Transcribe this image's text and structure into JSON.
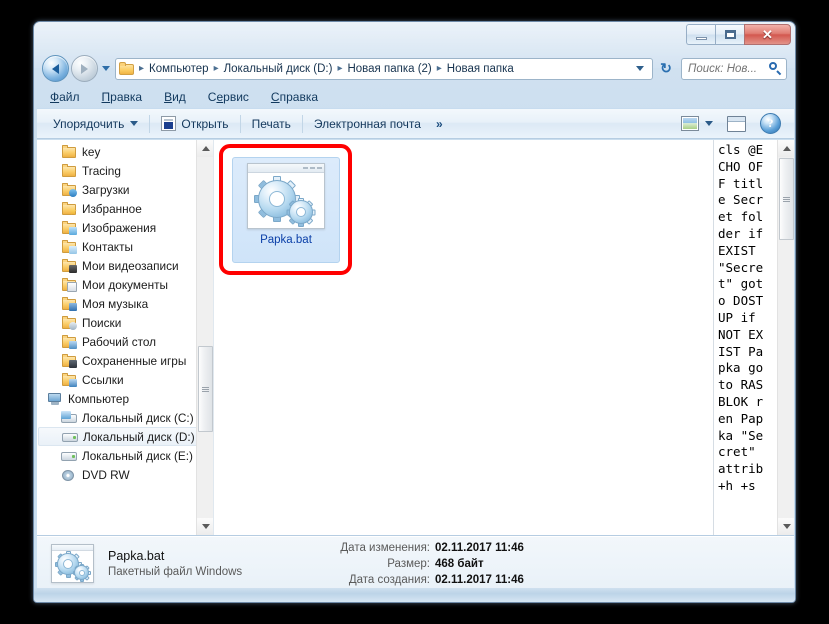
{
  "window": {
    "title": "",
    "controls": {
      "minimize": "–",
      "maximize": "□",
      "close": "✕"
    }
  },
  "nav": {
    "back_tooltip": "Назад",
    "forward_tooltip": "Вперед",
    "breadcrumbs": [
      "Компьютер",
      "Локальный диск (D:)",
      "Новая папка (2)",
      "Новая папка"
    ],
    "separator": "▸",
    "refresh": "↻",
    "search": {
      "placeholder": "Поиск: Нов...",
      "value": ""
    }
  },
  "menubar": {
    "items": [
      {
        "pre": "",
        "accel": "Ф",
        "post": "айл"
      },
      {
        "pre": "",
        "accel": "П",
        "post": "равка"
      },
      {
        "pre": "",
        "accel": "В",
        "post": "ид"
      },
      {
        "pre": "С",
        "accel": "е",
        "post": "рвис"
      },
      {
        "pre": "",
        "accel": "С",
        "post": "правка"
      }
    ]
  },
  "toolbar": {
    "organize": "Упорядочить",
    "open": "Открыть",
    "print": "Печать",
    "email": "Электронная почта",
    "overflow": "»",
    "help": "?"
  },
  "sidebar": {
    "items": [
      {
        "label": "key",
        "icon": "folder-icon",
        "kind": "folder",
        "level": 1,
        "selected": false
      },
      {
        "label": "Tracing",
        "icon": "folder-icon",
        "kind": "folder",
        "level": 1,
        "selected": false
      },
      {
        "label": "Загрузки",
        "icon": "downloads-folder-icon",
        "kind": "folder",
        "badge": "dl",
        "level": 1,
        "selected": false
      },
      {
        "label": "Избранное",
        "icon": "favorites-folder-icon",
        "kind": "folder",
        "badge": "fav",
        "level": 1,
        "selected": false
      },
      {
        "label": "Изображения",
        "icon": "pictures-folder-icon",
        "kind": "folder",
        "badge": "pic",
        "level": 1,
        "selected": false
      },
      {
        "label": "Контакты",
        "icon": "contacts-folder-icon",
        "kind": "folder",
        "badge": "cont",
        "level": 1,
        "selected": false
      },
      {
        "label": "Мои видеозаписи",
        "icon": "videos-folder-icon",
        "kind": "folder",
        "badge": "vid",
        "level": 1,
        "selected": false
      },
      {
        "label": "Мои документы",
        "icon": "documents-folder-icon",
        "kind": "folder",
        "badge": "doc",
        "level": 1,
        "selected": false
      },
      {
        "label": "Моя музыка",
        "icon": "music-folder-icon",
        "kind": "folder",
        "badge": "mus",
        "level": 1,
        "selected": false
      },
      {
        "label": "Поиски",
        "icon": "searches-folder-icon",
        "kind": "folder",
        "badge": "srch",
        "level": 1,
        "selected": false
      },
      {
        "label": "Рабочий стол",
        "icon": "desktop-folder-icon",
        "kind": "folder",
        "badge": "desk",
        "level": 1,
        "selected": false
      },
      {
        "label": "Сохраненные игры",
        "icon": "saved-games-folder-icon",
        "kind": "folder",
        "badge": "games",
        "level": 1,
        "selected": false
      },
      {
        "label": "Ссылки",
        "icon": "links-folder-icon",
        "kind": "folder",
        "badge": "link",
        "level": 1,
        "selected": false
      },
      {
        "label": "Компьютер",
        "icon": "computer-icon",
        "kind": "computer",
        "level": 0,
        "selected": false
      },
      {
        "label": "Локальный диск (C:)",
        "icon": "system-drive-icon",
        "kind": "sysdrive",
        "level": 1,
        "selected": false
      },
      {
        "label": "Локальный диск (D:)",
        "icon": "drive-icon",
        "kind": "drive",
        "level": 1,
        "selected": true
      },
      {
        "label": "Локальный диск (E:)",
        "icon": "drive-icon",
        "kind": "drive",
        "level": 1,
        "selected": false
      },
      {
        "label": "DVD RW",
        "icon": "dvd-drive-icon",
        "kind": "dvd",
        "level": 1,
        "selected": false
      }
    ]
  },
  "files": [
    {
      "name": "Papka.bat",
      "icon": "bat-file-icon",
      "selected": true,
      "highlighted": true
    }
  ],
  "preview": {
    "content": "cls @ECHO OFF title Secret folder if EXIST \"Secret\" goto DOSTUP if NOT EXIST Papka goto RASBLOK ren Papka \"Secret\" attrib +h +s"
  },
  "details": {
    "name": "Papka.bat",
    "type": "Пакетный файл Windows",
    "rows": [
      {
        "label": "Дата изменения:",
        "value": "02.11.2017 11:46"
      },
      {
        "label": "Размер:",
        "value": "468 байт"
      },
      {
        "label": "Дата создания:",
        "value": "02.11.2017 11:46"
      }
    ]
  },
  "colors": {
    "annotation_red": "#ff0000",
    "selection_blue": "#cfe4f9",
    "link_blue": "#0a3fa8",
    "frame_blue": "#bdd6ea"
  }
}
